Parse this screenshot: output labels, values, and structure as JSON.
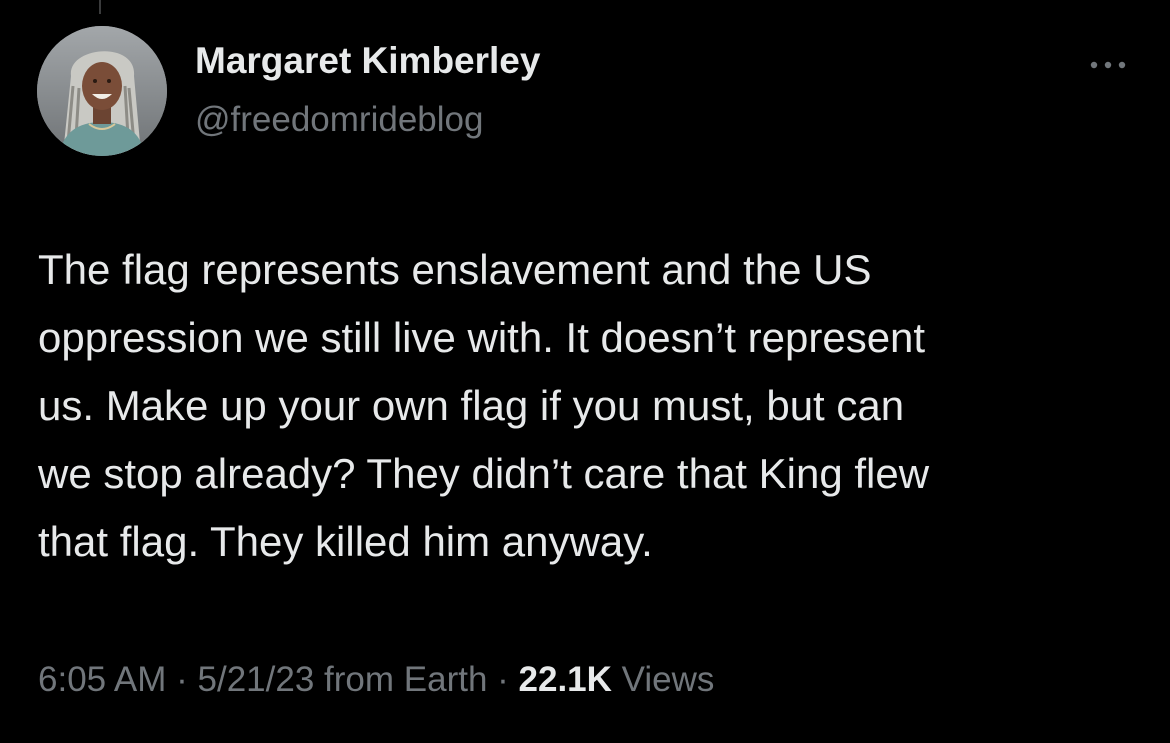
{
  "author": {
    "name": "Margaret Kimberley",
    "handle": "@freedomrideblog"
  },
  "more_icon": "more-horizontal-icon",
  "tweet": {
    "text": "The flag represents enslavement and the US\noppression we still live with. It doesn’t represent\nus. Make up your own flag if you must, but can\nwe stop already? They didn’t care that King flew\nthat flag. They killed him anyway."
  },
  "meta": {
    "time": "6:05 AM",
    "separator": " · ",
    "date": "5/21/23",
    "source": " from Earth",
    "views_count": "22.1K",
    "views_label": " Views"
  },
  "colors": {
    "background": "#000000",
    "primary_text": "#e7e9ea",
    "secondary_text": "#71767b"
  }
}
